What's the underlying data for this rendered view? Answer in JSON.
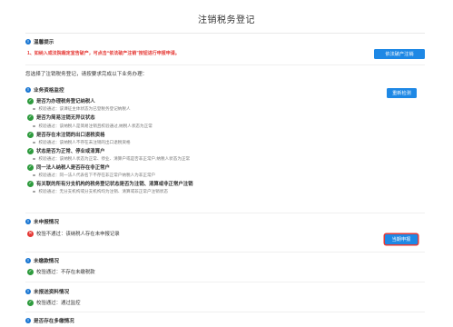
{
  "page": {
    "title": "注销税务登记"
  },
  "reminder": {
    "heading": "温馨提示",
    "text": "1、如纳入或法院裁定宣告破产，可点击“依法破产注销”按钮进行申报申请。",
    "button": "依法破产注销"
  },
  "intro": "您选择了注销税务登记，请按要求完成以下业务办理：",
  "qualification": {
    "heading": "业务资格监控",
    "recheck_button": "重新检测",
    "items": [
      {
        "title": "是否为办理税务登记纳税人",
        "status": "pass",
        "detail": "校验通过：该课征主体状态为已登税务登记纳税人"
      },
      {
        "title": "是否为简易注销无异议状态",
        "status": "pass",
        "detail": "校验通过：该纳税人是简易注销且校验通过,纳税人状态为正常"
      },
      {
        "title": "是否存在未注销的出口退税资格",
        "status": "pass",
        "detail": "校验通过：该纳税人不存在未注销的出口退税资格"
      },
      {
        "title": "状态是否为正常、停业或清算户",
        "status": "pass",
        "detail": "校验通过：该纳税人状态为正常、停业、清算户或是否非正常户,纳税人状态为正常"
      },
      {
        "title": "同一法人纳税人是否存在非正常户",
        "status": "pass",
        "detail": "校验通过：同一法人代表名下不存在非正常户纳税人为非正常户"
      },
      {
        "title": "有关联的所有分支机构的税务登记状态是否为注销、清算或非正常户注销",
        "status": "pass",
        "detail": "校验通过：无分支机构或分支机构均为注销、清算或非正常户注销状态"
      }
    ]
  },
  "undeclared": {
    "heading": "未申报情况",
    "result": "校验不通过：该纳税人存在未申报记录",
    "button": "当期申报"
  },
  "unpaid": {
    "heading": "未缴款情况",
    "result": "校验通过：不存在未缴税款"
  },
  "unreported_docs": {
    "heading": "未报送资料情况",
    "result": "校验通过：通过监控"
  },
  "multi_report": {
    "heading": "是否存在多缴情况"
  }
}
